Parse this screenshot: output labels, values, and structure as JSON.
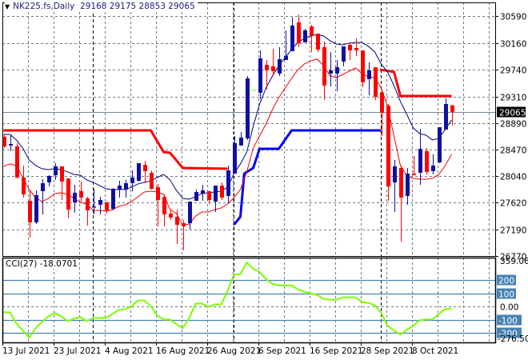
{
  "header": {
    "symbol": "NK225.fs,Daily",
    "open": "29168",
    "high": "29175",
    "low": "28853",
    "close": "29065"
  },
  "indicator": {
    "name": "CCI(27)",
    "value": "-18.0701"
  },
  "colors": {
    "bull": "#1010a0",
    "bear": "#ff0000",
    "doji": "#66ff00",
    "ma_fast": "#000080",
    "ma_slow": "#ff0000",
    "upper_band": "#ff0000",
    "lower_band": "#0000ff",
    "cci": "#7cfc00",
    "cci_level": "#4682b4",
    "grid": "#6e7b8b",
    "price_tag": "#000000"
  },
  "chart_data": [
    {
      "type": "candlestick",
      "title": "NK225.fs,Daily",
      "ylim": [
        26770,
        30590
      ],
      "y_ticks": [
        "30590",
        "30160",
        "29740",
        "29310",
        "28890",
        "28470",
        "28040",
        "27620",
        "27190",
        "26770"
      ],
      "current_price": "29065",
      "x_ticks": [
        {
          "bar": 0,
          "label": "13 Jul 2021"
        },
        {
          "bar": 8,
          "label": "23 Jul 2021"
        },
        {
          "bar": 16,
          "label": "4 Aug 2021"
        },
        {
          "bar": 24,
          "label": "16 Aug 2021"
        },
        {
          "bar": 32,
          "label": "26 Aug 2021"
        },
        {
          "bar": 40,
          "label": "6 Sep 2021"
        },
        {
          "bar": 48,
          "label": "16 Sep 2021"
        },
        {
          "bar": 56,
          "label": "28 Sep 2021"
        },
        {
          "bar": 64,
          "label": "8 Oct 2021"
        }
      ],
      "period_separators_bar": [
        13.9,
        35.9,
        58.9
      ],
      "ohlc": [
        [
          28669,
          28707,
          28490,
          28516
        ],
        [
          28529,
          28707,
          28440,
          28554
        ],
        [
          28516,
          28567,
          28007,
          28020
        ],
        [
          28020,
          28210,
          27701,
          27752
        ],
        [
          27650,
          27816,
          27065,
          27307
        ],
        [
          27307,
          27816,
          27281,
          27739
        ],
        [
          27803,
          27994,
          27434,
          27931
        ],
        [
          27943,
          28058,
          27880,
          28045
        ],
        [
          28058,
          28249,
          27982,
          28198
        ],
        [
          28198,
          28198,
          27663,
          27956
        ],
        [
          28007,
          28007,
          27371,
          27510
        ],
        [
          27625,
          27905,
          27460,
          27778
        ],
        [
          27803,
          27956,
          27638,
          27701
        ],
        [
          27688,
          27714,
          27256,
          27498
        ],
        [
          27548,
          27841,
          27434,
          27561
        ],
        [
          27587,
          27714,
          27434,
          27663
        ],
        [
          27625,
          27638,
          27447,
          27498
        ],
        [
          27523,
          27854,
          27498,
          27841
        ],
        [
          27829,
          27969,
          27701,
          27892
        ],
        [
          27829,
          27982,
          27701,
          27931
        ],
        [
          27931,
          28134,
          27803,
          28020
        ],
        [
          27969,
          28249,
          27956,
          28249
        ],
        [
          28223,
          28287,
          27931,
          28121
        ],
        [
          28096,
          28134,
          27829,
          27841
        ],
        [
          27867,
          27918,
          27243,
          27663
        ],
        [
          27714,
          27752,
          27243,
          27434
        ],
        [
          27447,
          27510,
          27345,
          27383
        ],
        [
          27396,
          27510,
          26963,
          27269
        ],
        [
          27294,
          27345,
          26861,
          27243
        ],
        [
          27294,
          27638,
          27192,
          27638
        ],
        [
          27650,
          27829,
          27650,
          27790
        ],
        [
          27765,
          27905,
          27650,
          27816
        ],
        [
          27803,
          27803,
          27599,
          27663
        ],
        [
          27638,
          27892,
          27472,
          27892
        ],
        [
          27892,
          27943,
          27663,
          27701
        ],
        [
          27727,
          28210,
          27612,
          28134
        ],
        [
          28083,
          28681,
          28083,
          28567
        ],
        [
          28529,
          28745,
          28529,
          28656
        ],
        [
          28643,
          29636,
          28618,
          29598
        ],
        [
          29407,
          29407,
          29407,
          29407
        ],
        [
          29369,
          30043,
          29267,
          29916
        ],
        [
          29814,
          29890,
          29420,
          29725
        ],
        [
          29789,
          30069,
          29636,
          29712
        ],
        [
          29674,
          30094,
          29636,
          29903
        ],
        [
          29890,
          30361,
          29890,
          29954
        ],
        [
          30030,
          30565,
          30030,
          30438
        ],
        [
          30489,
          30616,
          30094,
          30158
        ],
        [
          30170,
          30387,
          30170,
          30361
        ],
        [
          30425,
          30450,
          30018,
          30272
        ],
        [
          30310,
          30310,
          30018,
          30056
        ],
        [
          30094,
          30183,
          29254,
          29483
        ],
        [
          29674,
          30018,
          29470,
          29725
        ],
        [
          29674,
          29890,
          29394,
          29776
        ],
        [
          29865,
          30107,
          29789,
          30107
        ],
        [
          30132,
          30170,
          29890,
          30043
        ],
        [
          30081,
          30234,
          29954,
          30043
        ],
        [
          30043,
          30043,
          29458,
          29534
        ],
        [
          29586,
          29852,
          29330,
          29725
        ],
        [
          29776,
          29776,
          29254,
          29305
        ],
        [
          29369,
          29407,
          28681,
          29050
        ],
        [
          29165,
          29190,
          27650,
          27880
        ],
        [
          27943,
          28300,
          27472,
          28198
        ],
        [
          28172,
          28210,
          27001,
          27701
        ],
        [
          27727,
          28172,
          27587,
          28083
        ],
        [
          28083,
          28363,
          28058,
          28058
        ],
        [
          28096,
          28793,
          27905,
          28478
        ],
        [
          28440,
          28490,
          28070,
          28109
        ],
        [
          28121,
          28389,
          28070,
          28210
        ],
        [
          28261,
          28821,
          28249,
          28821
        ],
        [
          28783,
          29280,
          28783,
          29190
        ],
        [
          29168,
          29175,
          28853,
          29065
        ]
      ],
      "ma_fast": [
        28707,
        28707,
        28618,
        28490,
        28300,
        28210,
        28160,
        28147,
        28160,
        28147,
        28109,
        28070,
        28058,
        27982,
        27943,
        27892,
        27841,
        27829,
        27829,
        27829,
        27867,
        27918,
        27943,
        27969,
        28020,
        28070,
        27982,
        27816,
        27688,
        27676,
        27714,
        27765,
        27778,
        27790,
        27803,
        27867,
        28083,
        28236,
        28427,
        28834,
        29190,
        29445,
        29636,
        29801,
        29929,
        30056,
        30170,
        30234,
        30272,
        30298,
        30272,
        30196,
        30145,
        30132,
        30158,
        30170,
        30170,
        30107,
        30018,
        29827,
        29700,
        29483,
        29229,
        29025,
        28809,
        28720,
        28694,
        28618,
        28643,
        28783,
        28936
      ],
      "ma_slow": [
        28198,
        28236,
        28210,
        28020,
        27829,
        27701,
        27638,
        27688,
        27765,
        27778,
        27752,
        27688,
        27625,
        27599,
        27498,
        27498,
        27485,
        27510,
        27561,
        27587,
        27638,
        27714,
        27790,
        27803,
        27790,
        27752,
        27510,
        27447,
        27256,
        27281,
        27409,
        27472,
        27472,
        27510,
        27536,
        27599,
        27701,
        27829,
        28109,
        28490,
        28681,
        28872,
        29101,
        29292,
        29445,
        29598,
        29738,
        29827,
        29878,
        29903,
        29801,
        29636,
        29611,
        29661,
        29712,
        29763,
        29674,
        29623,
        29611,
        29445,
        29152,
        28681,
        28210,
        28045,
        28007,
        27994,
        27994,
        28007,
        28070,
        28210,
        28389
      ],
      "upper_band": [
        [
          [
            0,
            28770
          ],
          [
            23,
            28770
          ],
          [
            25,
            28427
          ],
          [
            26,
            28414
          ],
          [
            28,
            28172
          ],
          [
            35,
            28160
          ]
        ],
        [
          [
            58.8,
            29738
          ],
          [
            61,
            29700
          ],
          [
            62,
            29318
          ],
          [
            70,
            29318
          ]
        ]
      ],
      "lower_band": [
        [
          [
            36,
            27269
          ],
          [
            37,
            27396
          ],
          [
            37.6,
            28083
          ],
          [
            39,
            28172
          ],
          [
            40,
            28478
          ],
          [
            43,
            28478
          ],
          [
            45,
            28770
          ],
          [
            59,
            28770
          ]
        ]
      ]
    },
    {
      "type": "line",
      "title": "CCI(27) -18.0701",
      "ylim": [
        -276.5025,
        359.0614
      ],
      "y_labels": {
        "top": "359.0614",
        "bottom": "-276.5025",
        "zero": "0.00"
      },
      "levels": [
        {
          "value": 200,
          "label": "200"
        },
        {
          "value": 100,
          "label": "100"
        },
        {
          "value": -100,
          "label": "-100"
        },
        {
          "value": -200,
          "label": "-200"
        }
      ],
      "values": [
        -45,
        -45,
        -130,
        -183,
        -237,
        -165,
        -117,
        -75,
        -51,
        -75,
        -111,
        -93,
        -81,
        -111,
        -87,
        -87,
        -87,
        -57,
        -27,
        -21,
        3,
        45,
        45,
        3,
        -69,
        -99,
        -99,
        -135,
        -165,
        -87,
        21,
        21,
        -3,
        15,
        15,
        117,
        243,
        243,
        333,
        285,
        261,
        207,
        171,
        159,
        159,
        159,
        129,
        111,
        99,
        87,
        57,
        51,
        51,
        69,
        69,
        69,
        33,
        27,
        9,
        -51,
        -147,
        -183,
        -213,
        -177,
        -147,
        -105,
        -99,
        -99,
        -57,
        -21,
        -18.07
      ]
    }
  ]
}
